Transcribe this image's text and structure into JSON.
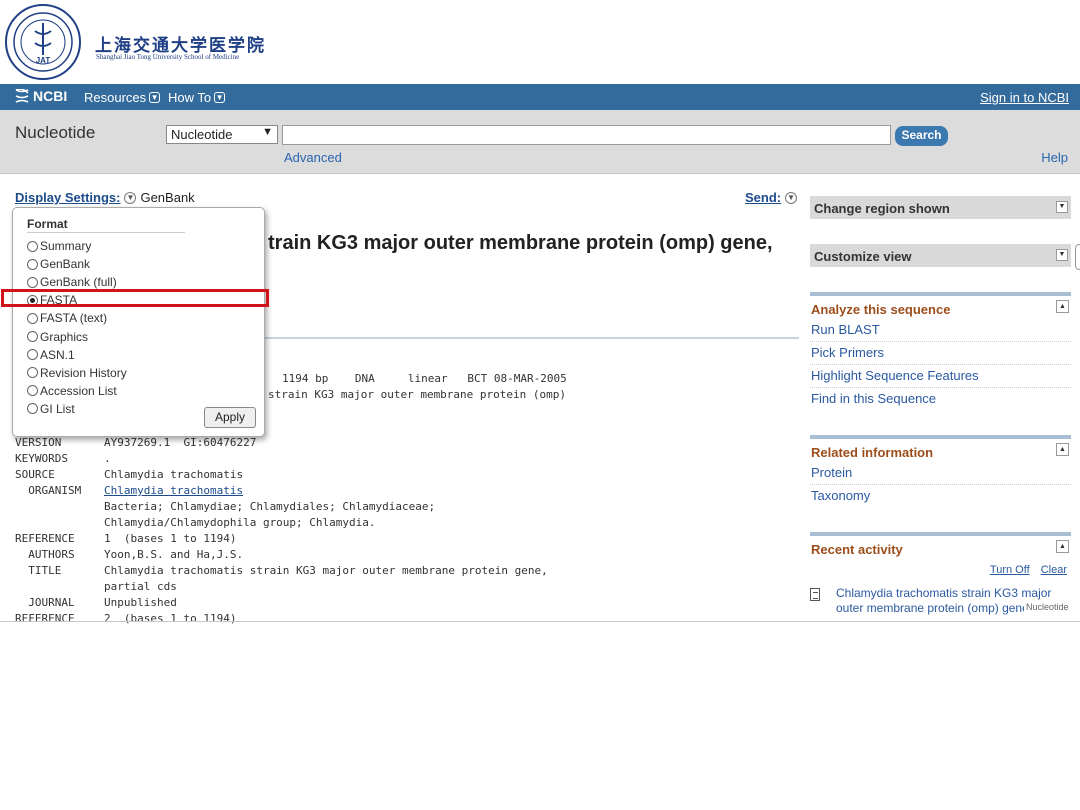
{
  "colors": {
    "nav_bg": "#336b9c",
    "search_band": "#dcdcdc",
    "link": "#2a59a0",
    "portlet_head": "#9b4e1c",
    "highlight": "#d0141a"
  },
  "logo": {
    "cn": "上海交通大学医学院",
    "en": "Shanghai Jiao Tong University School of Medicine",
    "seal_center": "JAT"
  },
  "nav": {
    "brand": "NCBI",
    "resources": "Resources",
    "howto": "How To",
    "signin": "Sign in to NCBI"
  },
  "search": {
    "db_title": "Nucleotide",
    "db_selected": "Nucleotide",
    "term": "",
    "button": "Search",
    "advanced": "Advanced",
    "help": "Help"
  },
  "display": {
    "label": "Display Settings:",
    "current": "GenBank",
    "send": "Send:"
  },
  "record": {
    "title_visible": "train KG3 major outer membrane protein (omp) gene,"
  },
  "format_popup": {
    "heading": "Format",
    "options": [
      "Summary",
      "GenBank",
      "GenBank (full)",
      "FASTA",
      "FASTA (text)",
      "Graphics",
      "ASN.1",
      "Revision History",
      "Accession List",
      "GI List"
    ],
    "selected": "FASTA",
    "apply": "Apply"
  },
  "genbank": {
    "locus_tail": "1194 bp    DNA     linear   BCT 08-MAR-2005",
    "definition_tail": "strain KG3 major outer membrane protein (omp)",
    "rows": [
      {
        "key": "VERSION",
        "val": "AY937269.1  GI:60476227"
      },
      {
        "key": "KEYWORDS",
        "val": "."
      },
      {
        "key": "SOURCE",
        "val": "Chlamydia trachomatis"
      },
      {
        "key": "  ORGANISM",
        "val": "Chlamydia trachomatis",
        "link": true
      },
      {
        "key": "",
        "val": "Bacteria; Chlamydiae; Chlamydiales; Chlamydiaceae;"
      },
      {
        "key": "",
        "val": "Chlamydia/Chlamydophila group; Chlamydia."
      },
      {
        "key": "REFERENCE",
        "val": "1  (bases 1 to 1194)"
      },
      {
        "key": "  AUTHORS",
        "val": "Yoon,B.S. and Ha,J.S."
      },
      {
        "key": "  TITLE",
        "val": "Chlamydia trachomatis strain KG3 major outer membrane protein gene,"
      },
      {
        "key": "",
        "val": "partial cds"
      },
      {
        "key": "  JOURNAL",
        "val": "Unpublished"
      },
      {
        "key": "REFERENCE",
        "val": "2  (bases 1 to 1194)"
      }
    ]
  },
  "sidebar": {
    "change_region": "Change region shown",
    "customize": "Customize view",
    "analyze": {
      "title": "Analyze this sequence",
      "items": [
        "Run BLAST",
        "Pick Primers",
        "Highlight Sequence Features",
        "Find in this Sequence"
      ]
    },
    "related": {
      "title": "Related information",
      "items": [
        "Protein",
        "Taxonomy"
      ]
    },
    "recent": {
      "title": "Recent activity",
      "turn_off": "Turn Off",
      "clear": "Clear",
      "item_line1": "Chlamydia trachomatis strain KG3 major",
      "item_line2": "outer membrane protein (omp) gene",
      "item_tag": "Nucleotide"
    }
  }
}
